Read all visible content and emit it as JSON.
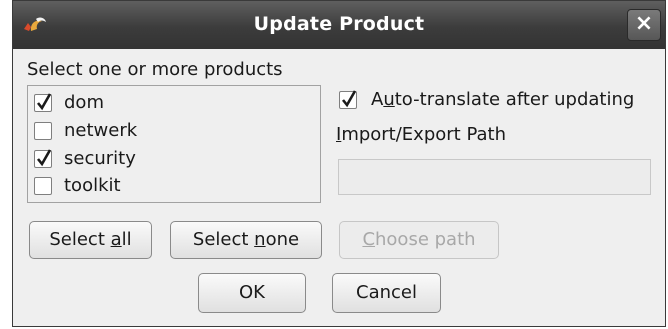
{
  "window": {
    "title": "Update Product",
    "close_glyph": "×"
  },
  "prompt": "Select one or more products",
  "products": [
    {
      "name": "dom",
      "checked": true
    },
    {
      "name": "netwerk",
      "checked": false
    },
    {
      "name": "security",
      "checked": true
    },
    {
      "name": "toolkit",
      "checked": false
    }
  ],
  "auto_translate": {
    "pre": "A",
    "mnemonic": "u",
    "post": "to-translate after updating",
    "checked": true
  },
  "path": {
    "mnemonic": "I",
    "post": "mport/Export Path",
    "value": ""
  },
  "buttons": {
    "select_all": {
      "pre": "Select ",
      "mnemonic": "a",
      "post": "ll"
    },
    "select_none": {
      "pre": "Select ",
      "mnemonic": "n",
      "post": "one"
    },
    "choose_path": {
      "pre": "",
      "mnemonic": "C",
      "post": "hoose path",
      "enabled": false
    },
    "ok": "OK",
    "cancel": "Cancel"
  },
  "icons": {
    "app": "firefox-logo-icon",
    "close": "close-icon",
    "check": "checkmark-icon"
  },
  "colors": {
    "titlebar": "#3c3c3c",
    "dialog_bg": "#efefef",
    "checkmark": "#1b1b1b",
    "disabled_text": "#a8a8a8"
  }
}
